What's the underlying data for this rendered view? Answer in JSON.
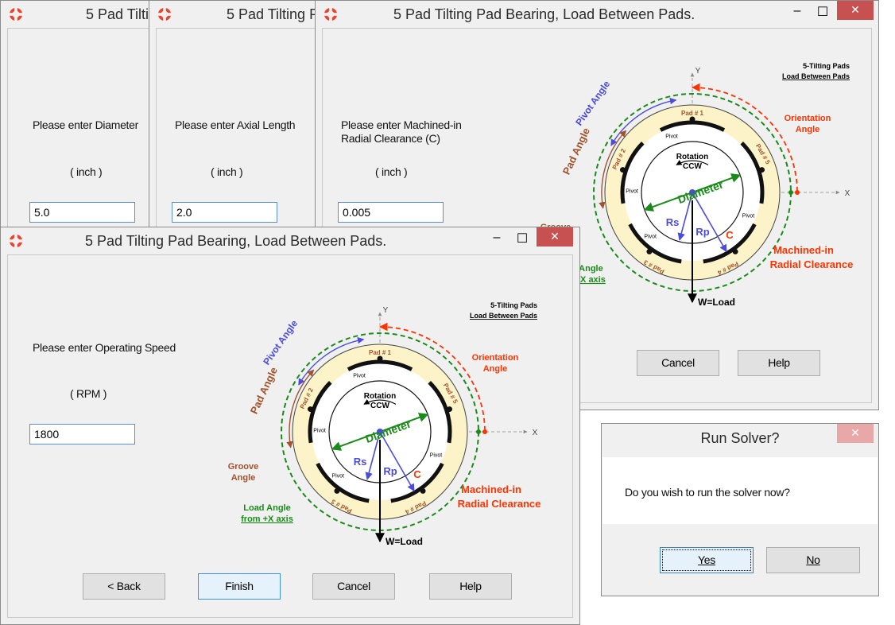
{
  "windows": {
    "diameter": {
      "title": "5 Pad Tilting Pad Bearing, Load Between Pads.",
      "prompt": "Please enter Diameter",
      "unit": "( inch )",
      "value": "5.0"
    },
    "axial": {
      "title": "5 Pad Tilting Pad Bearing, Load Between Pads.",
      "prompt": "Please enter Axial Length",
      "unit": "( inch )",
      "value": "2.0"
    },
    "clearance": {
      "title": "5 Pad Tilting Pad Bearing, Load Between Pads.",
      "prompt": "Please enter Machined-in Radial Clearance (C)",
      "unit": "( inch )",
      "value": "0.005",
      "cancel": "Cancel",
      "help": "Help"
    },
    "speed": {
      "title": "5 Pad Tilting Pad Bearing, Load Between Pads.",
      "prompt": "Please enter Operating Speed",
      "unit": "( RPM )",
      "value": "1800",
      "back": "< Back",
      "finish": "Finish",
      "cancel": "Cancel",
      "help": "Help"
    }
  },
  "window_controls": {
    "minimize": "–",
    "maximize": "☐",
    "close": "✕"
  },
  "diagram": {
    "header_line1": "5-Tilting Pads",
    "header_line2": "Load Between Pads",
    "y_axis": "Y",
    "x_axis": "X",
    "pivot_angle": "Pivot Angle",
    "pad_angle": "Pad Angle",
    "groove_angle_1": "Groove",
    "groove_angle_2": "Angle",
    "load_angle_1": "Load Angle",
    "load_angle_2": "from +X axis",
    "orientation_1": "Orientation",
    "orientation_2": "Angle",
    "rotation_1": "Rotation",
    "rotation_2": "CCW",
    "diameter": "Diameter",
    "rs": "Rs",
    "rp": "Rp",
    "c": "C",
    "clearance_1": "Machined-in",
    "clearance_2": "Radial Clearance",
    "load": "W=Load",
    "pivot": "Pivot",
    "pad1": "Pad # 1",
    "pad2": "Pad # 2",
    "pad3": "Pad # 3",
    "pad4": "Pad # 4",
    "pad5": "Pad # 5"
  },
  "dialog": {
    "title": "Run Solver?",
    "message": "Do you wish to run the solver now?",
    "yes": "Yes",
    "no": "No",
    "close": "✕"
  },
  "colors": {
    "brown": "#a0522d",
    "blue": "#4b4bdc",
    "green": "#1a8a1a",
    "red": "#ff3300",
    "ring": "#fdf3c8"
  }
}
